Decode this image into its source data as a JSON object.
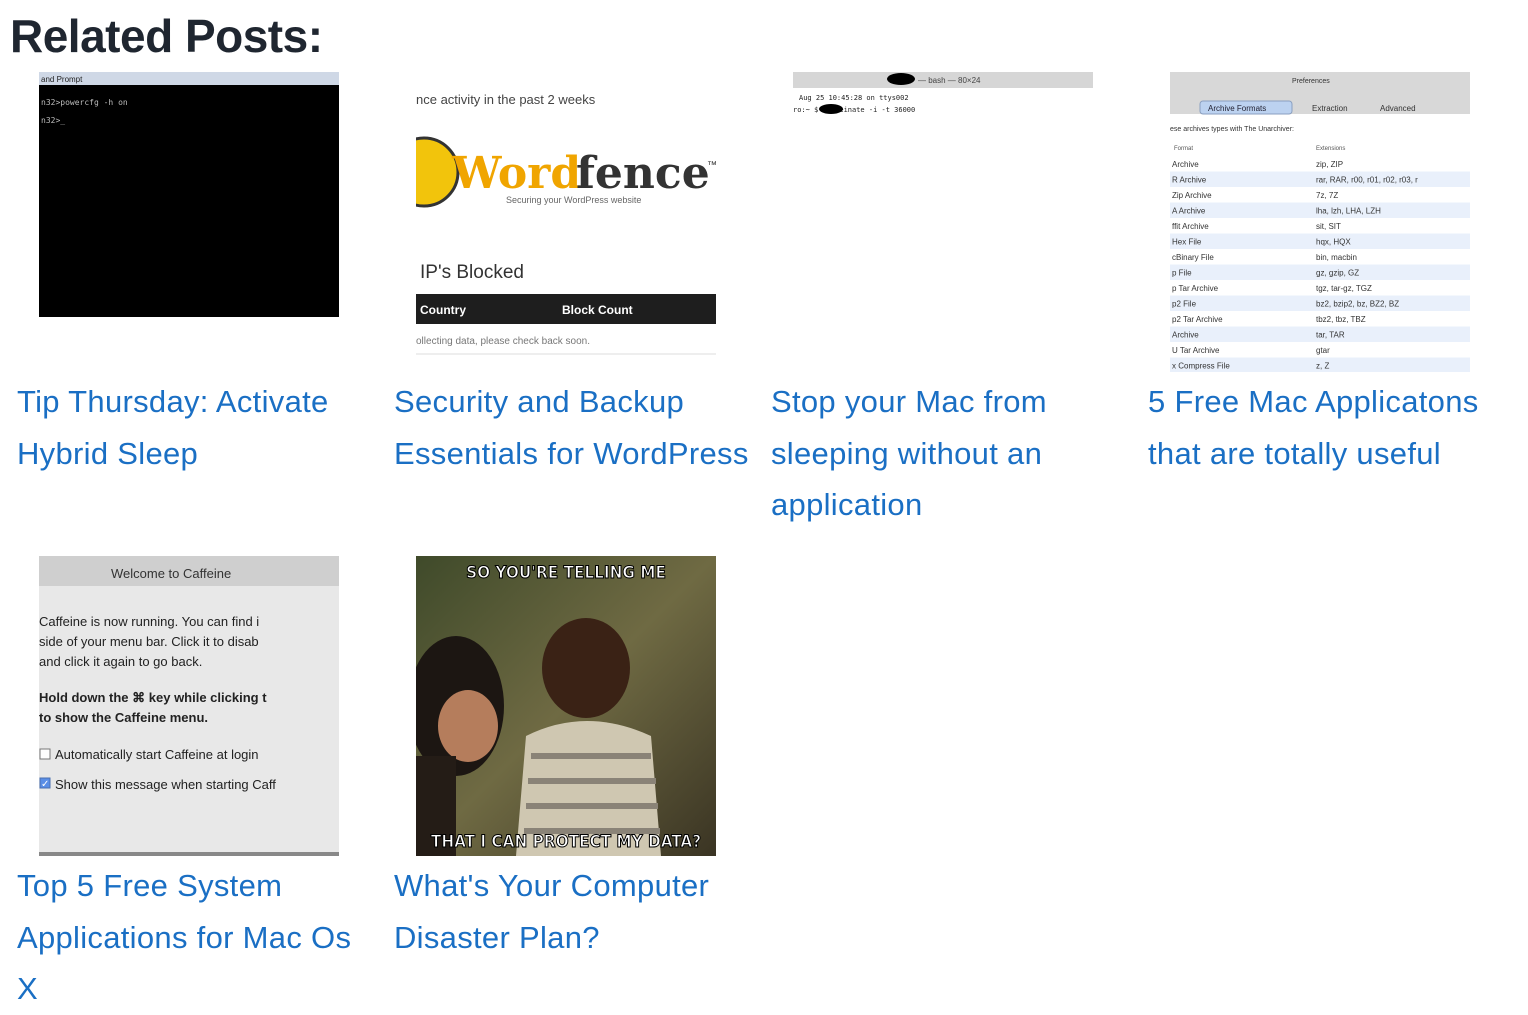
{
  "heading": "Related Posts:",
  "posts": [
    {
      "title": "Tip Thursday: Activate Hybrid Sleep",
      "thumb": {
        "titlebar": "and Prompt",
        "lines": [
          "n32>powercfg -h on",
          "n32>_"
        ]
      }
    },
    {
      "title": "Security and Backup Essentials for WordPress",
      "thumb": {
        "activity": "nce activity in the past 2 weeks",
        "logo_prefix": "Word",
        "logo_suffix": "fence",
        "tm": "™",
        "tagline": "Securing your WordPress website",
        "blocked": "IP's Blocked",
        "col1": "Country",
        "col2": "Block Count",
        "note": "ollecting data, please check back soon."
      }
    },
    {
      "title": "Stop your Mac from sleeping without an application",
      "thumb": {
        "titlebar": "— bash — 80×24",
        "line1": "Aug 25 10:45:28 on ttys002",
        "line2": "ro:~ $ caffeinate -i -t 36000"
      }
    },
    {
      "title": "5 Free Mac Applicatons that are totally useful",
      "thumb": {
        "titlebar": "Preferences",
        "tabs": [
          "Archive Formats",
          "Extraction",
          "Advanced"
        ],
        "intro": "ese archives types with The Unarchiver:",
        "header": [
          "Format",
          "Extensions"
        ],
        "rows": [
          [
            "Archive",
            "zip, ZIP"
          ],
          [
            "R Archive",
            "rar, RAR, r00, r01, r02, r03, r"
          ],
          [
            "Zip Archive",
            "7z, 7Z"
          ],
          [
            "A Archive",
            "lha, lzh, LHA, LZH"
          ],
          [
            "ffit Archive",
            "sit, SIT"
          ],
          [
            "Hex File",
            "hqx, HQX"
          ],
          [
            "cBinary File",
            "bin, macbin"
          ],
          [
            "p File",
            "gz, gzip, GZ"
          ],
          [
            "p Tar Archive",
            "tgz, tar-gz, TGZ"
          ],
          [
            "p2 File",
            "bz2, bzip2, bz, BZ2, BZ"
          ],
          [
            "p2 Tar Archive",
            "tbz2, tbz, TBZ"
          ],
          [
            "Archive",
            "tar, TAR"
          ],
          [
            "U Tar Archive",
            "gtar"
          ],
          [
            "x Compress File",
            "z, Z"
          ]
        ]
      }
    },
    {
      "title": "Top 5 Free System Applications for Mac Os X",
      "thumb": {
        "titlebar": "Welcome to Caffeine",
        "p1": [
          "Caffeine is now running. You can find i",
          "side of your menu bar. Click it to disab",
          "and click it again to go back."
        ],
        "p2": [
          "Hold down the ⌘ key while clicking t",
          "to show the Caffeine menu."
        ],
        "check1": "Automatically start Caffeine at login",
        "check2": "Show this message when starting Caff"
      }
    },
    {
      "title": "What's Your Computer Disaster Plan?",
      "thumb": {
        "top": "SO YOU'RE TELLING ME",
        "bottom": "THAT I CAN PROTECT MY DATA?"
      }
    }
  ],
  "colors": {
    "link": "#1a6fc4",
    "heading": "#1f2630"
  }
}
